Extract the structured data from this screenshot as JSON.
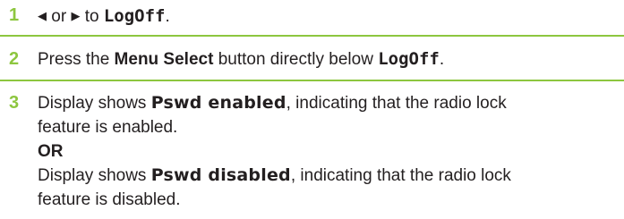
{
  "colors": {
    "step_number": "#8dc63f",
    "rule": "#8dc63f",
    "text": "#231f20"
  },
  "steps": [
    {
      "number": "1",
      "left_arrow": "◀",
      "or_text": " or ",
      "right_arrow": "▶",
      "to_text": " to ",
      "target": "LogOff",
      "end": "."
    },
    {
      "number": "2",
      "pre": "Press the ",
      "button": "Menu Select",
      "mid": " button directly below ",
      "target": "LogOff",
      "end": "."
    },
    {
      "number": "3",
      "a_pre": "Display shows ",
      "a_state": "Pswd enabled",
      "a_post": ", indicating that the radio lock",
      "a_cont": "feature is enabled.",
      "or_label": "OR",
      "b_pre": "Display shows ",
      "b_state": "Pswd disabled",
      "b_post": ", indicating that the radio lock",
      "b_cont": "feature is disabled."
    }
  ]
}
